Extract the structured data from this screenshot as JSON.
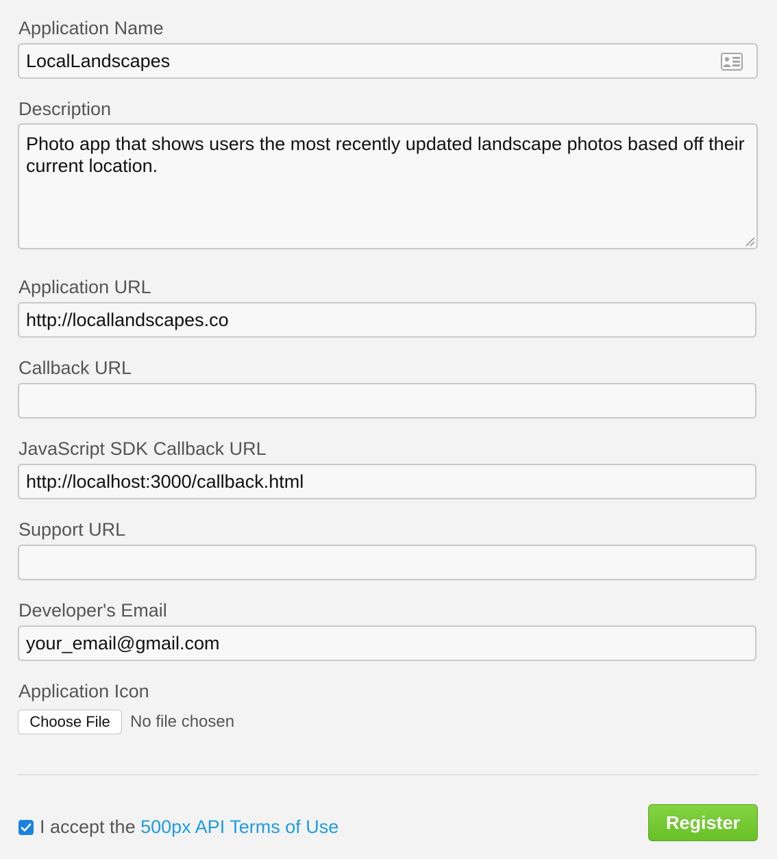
{
  "form": {
    "app_name": {
      "label": "Application Name",
      "value": "LocalLandscapes",
      "icon": "contact-card-icon"
    },
    "description": {
      "label": "Description",
      "value": "Photo app that shows users the most recently updated landscape photos based off their current location."
    },
    "app_url": {
      "label": "Application URL",
      "value": "http://locallandscapes.co"
    },
    "callback_url": {
      "label": "Callback URL",
      "value": ""
    },
    "js_sdk_callback_url": {
      "label": "JavaScript SDK Callback URL",
      "value": "http://localhost:3000/callback.html"
    },
    "support_url": {
      "label": "Support URL",
      "value": ""
    },
    "developer_email": {
      "label": "Developer's Email",
      "value": "your_email@gmail.com"
    },
    "app_icon": {
      "label": "Application Icon",
      "button_label": "Choose File",
      "status": "No file chosen"
    }
  },
  "footer": {
    "accept_prefix": "I accept the ",
    "terms_link": "500px API Terms of Use",
    "terms_checked": true,
    "register_label": "Register"
  },
  "colors": {
    "link": "#1c9be8",
    "register_button": "#6cc12b",
    "checkbox": "#1a82e2",
    "background": "#f3f3f3"
  }
}
